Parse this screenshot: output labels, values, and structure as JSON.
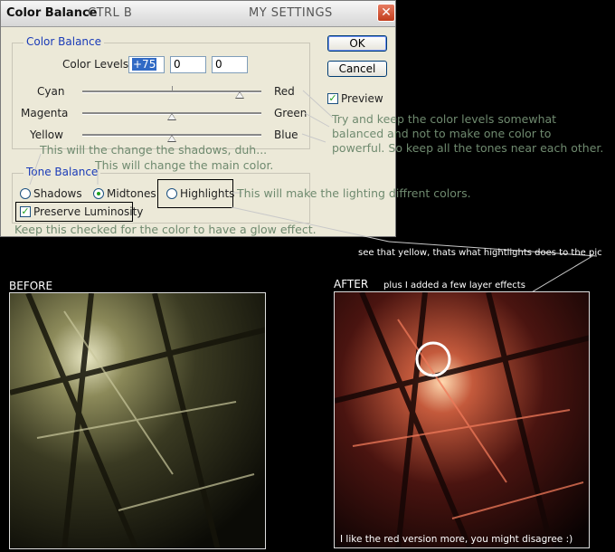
{
  "dialog": {
    "title": "Color Balance",
    "shortcut_note": "CTRL B",
    "settings_note": "MY SETTINGS",
    "close_glyph": "✕",
    "color_balance_group": "Color Balance",
    "color_levels_label": "Color Levels:",
    "levels": [
      "+75",
      "0",
      "0"
    ],
    "sliders": [
      {
        "left": "Cyan",
        "right": "Red",
        "value": 75
      },
      {
        "left": "Magenta",
        "right": "Green",
        "value": 0
      },
      {
        "left": "Yellow",
        "right": "Blue",
        "value": 0
      }
    ],
    "tone_balance_group": "Tone Balance",
    "tones": [
      {
        "label": "Shadows",
        "selected": false
      },
      {
        "label": "Midtones",
        "selected": true
      },
      {
        "label": "Highlights",
        "selected": false
      }
    ],
    "preserve_label": "Preserve Luminosity",
    "preserve_checked": true,
    "ok_label": "OK",
    "cancel_label": "Cancel",
    "preview_label": "Preview",
    "preview_checked": true,
    "check_glyph": "✓"
  },
  "annotations": {
    "levels_note_lines": [
      "Try and keep the color levels somewhat",
      "balanced and not to make one color to",
      "powerful. So keep all the tones near each other."
    ],
    "shadows_note": "This will the change the shadows, duh...",
    "midtones_note": "This will change the main color.",
    "highlights_note": "This will make the lighting diffrent colors.",
    "preserve_note": "Keep this checked for the color to have a glow effect.",
    "yellow_note": "see that yellow, thats what hightlights does to the pic",
    "layer_effects_note": "plus I added a few layer effects",
    "after_caption": "I like the red version more, you might disagree :)"
  },
  "images": {
    "before_label": "BEFORE",
    "after_label": "AFTER"
  },
  "colors": {
    "dialog_bg": "#ece9d8",
    "legend_blue": "#1a3bb8",
    "note_green": "#6f8a6f",
    "check_green": "#21a121",
    "close_red": "#c23d1c"
  }
}
